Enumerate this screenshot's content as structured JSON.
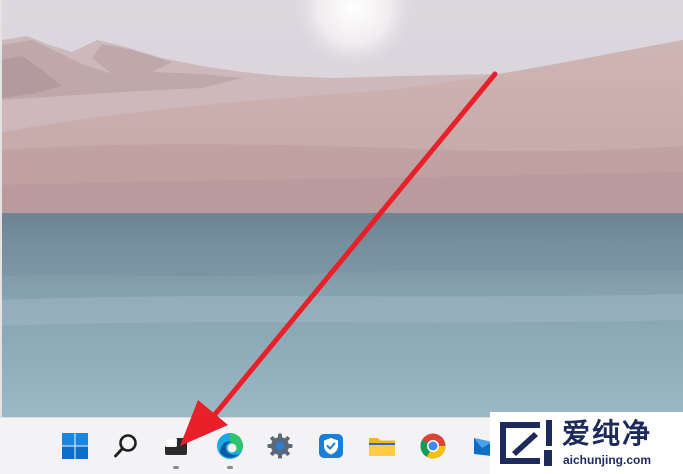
{
  "desktop": {
    "wallpaper": "desert dunes with lake",
    "colors": {
      "sky": "#d9d5dc",
      "dunes": "#c7a9a9",
      "lake": "#8ea9b6"
    }
  },
  "taskbar": {
    "icons": [
      {
        "id": "start",
        "icon": "windows-logo-icon"
      },
      {
        "id": "search",
        "icon": "search-icon"
      },
      {
        "id": "task-view",
        "icon": "task-view-icon",
        "running": true
      },
      {
        "id": "edge",
        "icon": "edge-icon",
        "running": true
      },
      {
        "id": "settings",
        "icon": "gear-icon"
      },
      {
        "id": "security",
        "icon": "shield-icon"
      },
      {
        "id": "explorer",
        "icon": "folder-icon"
      },
      {
        "id": "chrome",
        "icon": "chrome-icon"
      },
      {
        "id": "mail",
        "icon": "mail-icon"
      }
    ],
    "accent": "#0a78d7"
  },
  "annotation": {
    "color": "#e8202a"
  },
  "watermark": {
    "brand_cn": "爱纯净",
    "url": "aichunjing.com"
  }
}
